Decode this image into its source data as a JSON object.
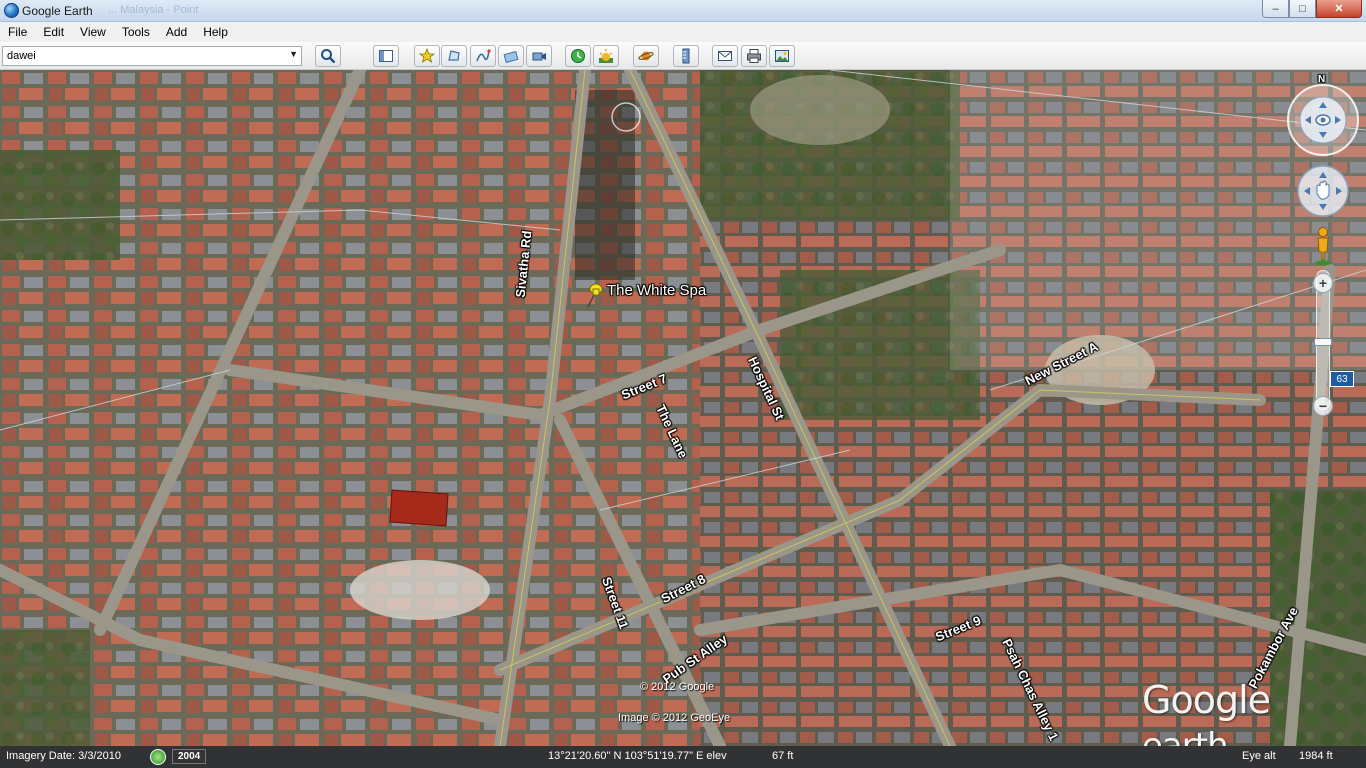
{
  "window": {
    "title": "Google Earth",
    "ghost_title": "... Malaysia - Point",
    "minimize": "–",
    "maximize": "□",
    "close": "✕"
  },
  "menu": [
    "File",
    "Edit",
    "View",
    "Tools",
    "Add",
    "Help"
  ],
  "search": {
    "value": "dawei",
    "dropdown_glyph": "▼"
  },
  "toolbar_icons": [
    "search-icon",
    "sidebar-icon",
    "placemark-icon",
    "polygon-icon",
    "path-icon",
    "overlay-icon",
    "tour-icon",
    "historical-imagery-icon",
    "sun-icon",
    "planets-icon",
    "ruler-icon",
    "email-icon",
    "print-icon",
    "save-image-icon"
  ],
  "map": {
    "placemark": "The White Spa",
    "roads": [
      {
        "id": "sivatha-rd",
        "label": "Sivatha Rd"
      },
      {
        "id": "hospital-st",
        "label": "Hospital St"
      },
      {
        "id": "street-7",
        "label": "Street 7"
      },
      {
        "id": "the-lane",
        "label": "The Lane"
      },
      {
        "id": "new-street-a",
        "label": "New Street A"
      },
      {
        "id": "street-11",
        "label": "Street 11"
      },
      {
        "id": "street-8",
        "label": "Street 8"
      },
      {
        "id": "pub-st-alley",
        "label": "Pub St Alley"
      },
      {
        "id": "street-9",
        "label": "Street 9"
      },
      {
        "id": "psah-chas-alley",
        "label": "Psah Chas Alley 1"
      },
      {
        "id": "pokambor-ave",
        "label": "Pokambor Ave"
      }
    ],
    "copyright_google": "© 2012 Google",
    "copyright_geoeye": "Image © 2012 GeoEye",
    "logo_google": "Google",
    "logo_earth": "earth",
    "compass_north": "N",
    "badge": "63"
  },
  "status": {
    "imagery_date": "Imagery Date: 3/3/2010",
    "year": "2004",
    "coords": "13°21'20.60\" N 103°51'19.77\" E elev",
    "elev": "67 ft",
    "eye_alt_label": "Eye alt",
    "eye_alt": "1984 ft"
  }
}
